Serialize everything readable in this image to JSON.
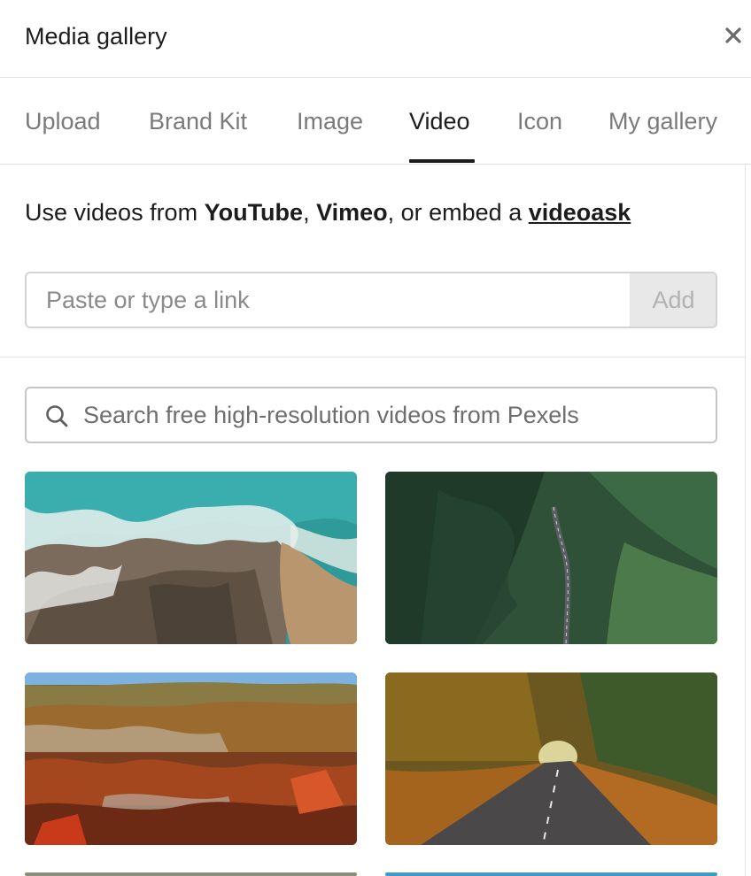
{
  "dialog": {
    "title": "Media gallery",
    "close_icon": "close-icon"
  },
  "tabs": [
    {
      "label": "Upload",
      "active": false
    },
    {
      "label": "Brand Kit",
      "active": false
    },
    {
      "label": "Image",
      "active": false
    },
    {
      "label": "Video",
      "active": true
    },
    {
      "label": "Icon",
      "active": false
    },
    {
      "label": "My gallery",
      "active": false
    }
  ],
  "intro": {
    "prefix": "Use videos from ",
    "youtube": "YouTube",
    "comma": ", ",
    "vimeo": "Vimeo",
    "middle": ", or embed a ",
    "videoask": "videoask"
  },
  "link_input": {
    "placeholder": "Paste or type a link",
    "value": "",
    "add_label": "Add"
  },
  "search": {
    "placeholder": "Search free high-resolution videos from Pexels",
    "value": "",
    "icon": "search-icon"
  },
  "videos": [
    {
      "subject": "aerial ocean waves on rocky coast"
    },
    {
      "subject": "aerial forest with winding road"
    },
    {
      "subject": "autumn valley with cliffs"
    },
    {
      "subject": "autumn road through trees"
    }
  ],
  "colors": {
    "text": "#1c1c1c",
    "muted_tab": "#7a7a7a",
    "border": "#d4d4d4",
    "add_bg": "#e8e8e8",
    "add_text": "#b2b2b2"
  }
}
